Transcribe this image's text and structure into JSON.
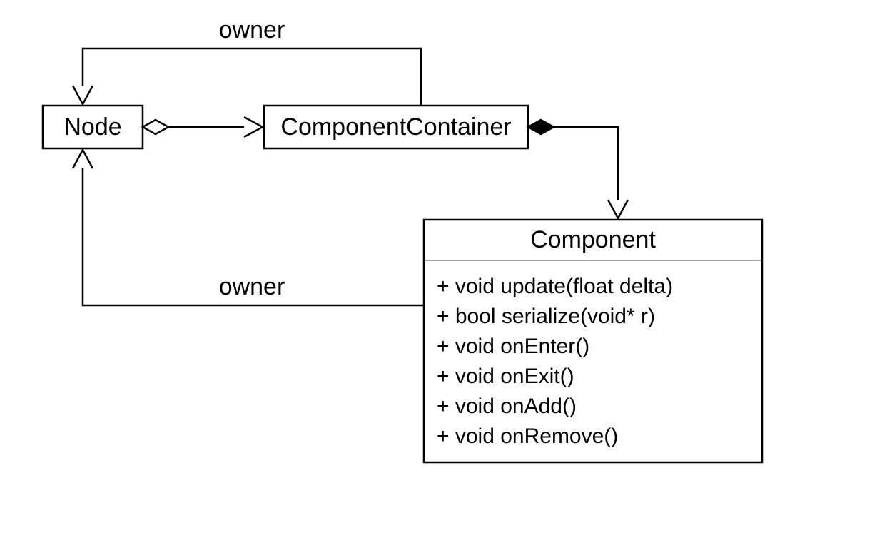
{
  "classes": {
    "node": {
      "name": "Node"
    },
    "componentContainer": {
      "name": "ComponentContainer"
    },
    "component": {
      "name": "Component",
      "members": [
        "+ void update(float delta)",
        "+ bool serialize(void* r)",
        "+ void onEnter()",
        "+ void onExit()",
        "+ void onAdd()",
        "+ void onRemove()"
      ]
    }
  },
  "edges": {
    "ownerTop": {
      "label": "owner"
    },
    "ownerBottom": {
      "label": "owner"
    }
  }
}
